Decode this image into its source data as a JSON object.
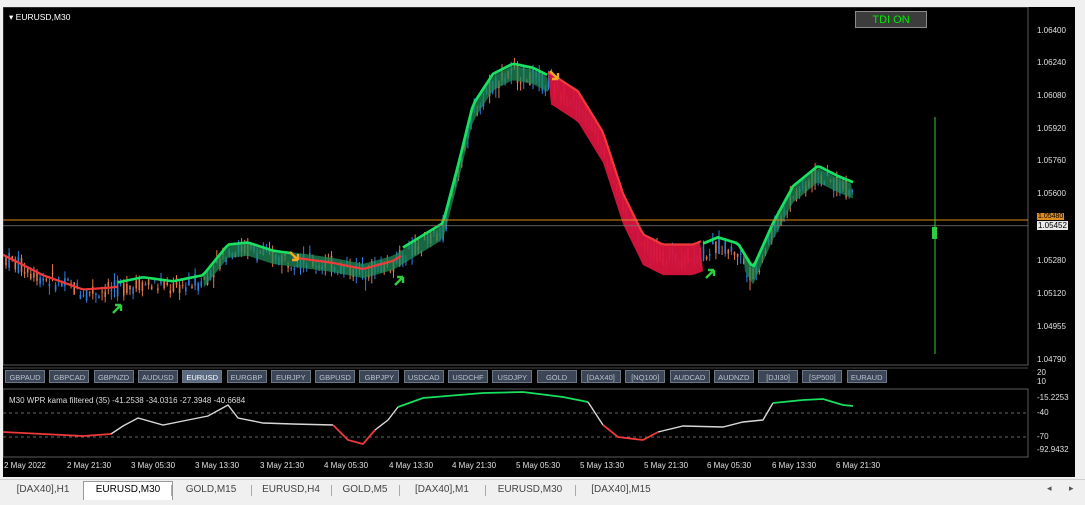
{
  "chart": {
    "title": "EURUSD,M30",
    "tdi_button": "TDI ON",
    "price_levels": [
      "1.06400",
      "1.06240",
      "1.06080",
      "1.05920",
      "1.05760",
      "1.05600",
      "1.05452",
      "1.05280",
      "1.05120",
      "1.04955",
      "1.04790"
    ],
    "current_price": "1.05452",
    "orange_level": "1.05480",
    "indicator_label": "M30  WPR kama filtered (35) -41.2538 -34.0316 -27.3948 -40.6684",
    "indicator_levels": [
      "20",
      "10",
      "-15.2253",
      "-40",
      "-70",
      "-92.9432"
    ],
    "time_labels": [
      "2 May 2022",
      "2 May 21:30",
      "3 May 05:30",
      "3 May 13:30",
      "3 May 21:30",
      "4 May 05:30",
      "4 May 13:30",
      "4 May 21:30",
      "5 May 05:30",
      "5 May 13:30",
      "5 May 21:30",
      "6 May 05:30",
      "6 May 13:30",
      "6 May 21:30"
    ],
    "symbols": [
      "GBPAUD",
      "GBPCAD",
      "GBPNZD",
      "AUDUSD",
      "EURUSD",
      "EURGBP",
      "EURJPY",
      "GBPUSD",
      "GBPJPY",
      "USDCAD",
      "USDCHF",
      "USDJPY",
      "GOLD",
      "[DAX40]",
      "[NQ100]",
      "AUDCAD",
      "AUDNZD",
      "[DJI30]",
      "[SP500]",
      "EURAUD"
    ],
    "active_symbol": "EURUSD",
    "colors": {
      "bull": "#2f7fe0",
      "bear": "#e0784a",
      "line_green": "#18e060",
      "line_red": "#f03a3a",
      "cloud_green": "#1f8a5a",
      "cloud_red": "#d9143e",
      "arrow_orange": "#f5a623",
      "arrow_green": "#2ecc40",
      "orange_line": "#e08a1a"
    }
  },
  "tabs": {
    "items": [
      "[DAX40],H1",
      "EURUSD,M30",
      "GOLD,M15",
      "EURUSD,H4",
      "GOLD,M5",
      "[DAX40],M1",
      "EURUSD,M30",
      "[DAX40],M15"
    ],
    "active_index": 1,
    "nav_left": "◂",
    "nav_right": "▸"
  }
}
